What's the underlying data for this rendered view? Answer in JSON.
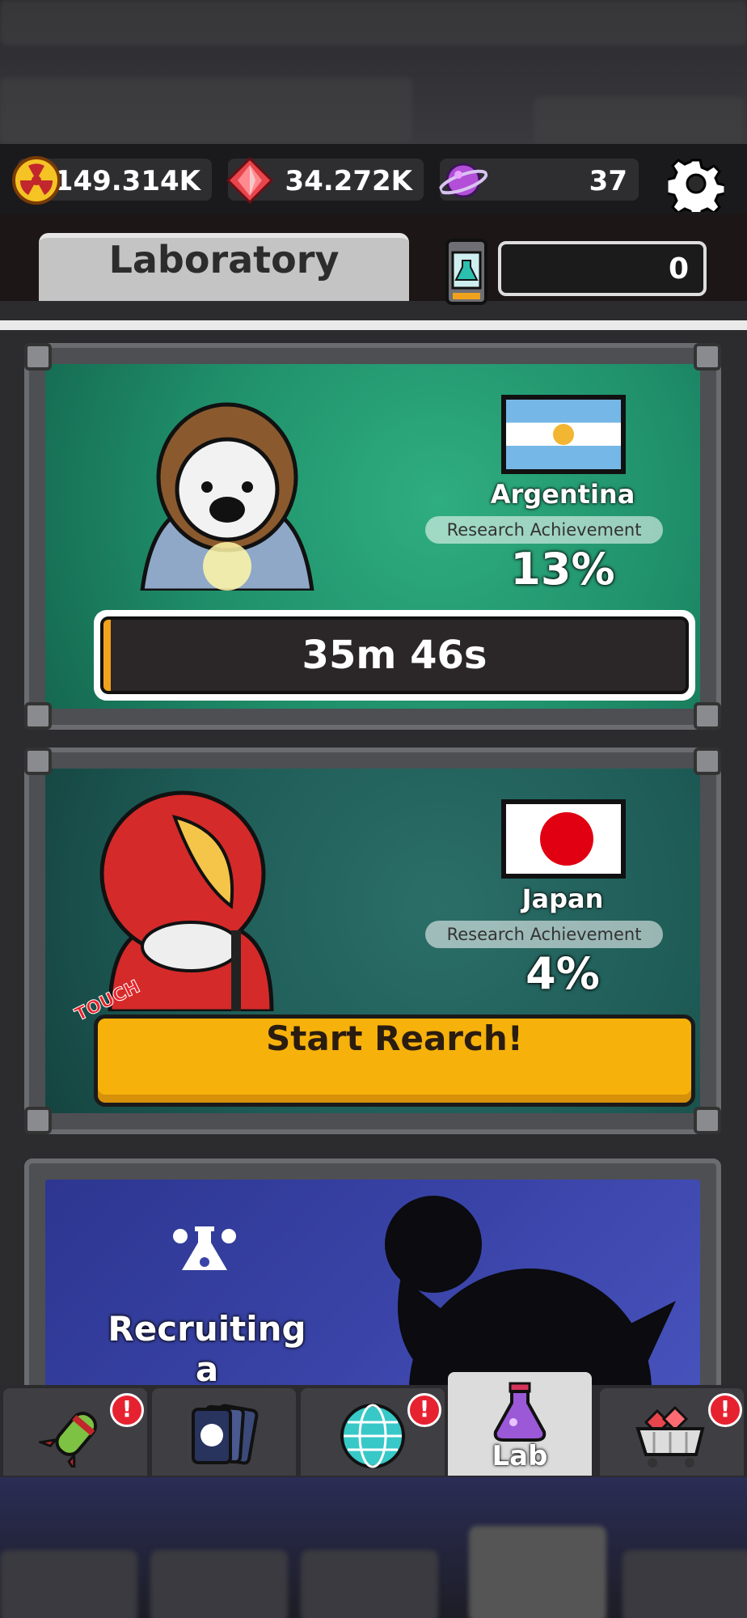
{
  "currencies": {
    "nuclear": {
      "value": "149.314K",
      "icon": "nuclear-icon"
    },
    "gem": {
      "value": "34.272K",
      "icon": "red-gem-icon"
    },
    "planet": {
      "value": "37",
      "icon": "planet-icon"
    }
  },
  "header": {
    "tab_label": "Laboratory",
    "ticket_count": "0"
  },
  "research": [
    {
      "country": "Argentina",
      "achievement_label": "Research Achievement",
      "achievement": "13%",
      "timer": "35m 46s"
    },
    {
      "country": "Japan",
      "achievement_label": "Research Achievement",
      "achievement": "4%",
      "action_label": "Start Rearch!",
      "touch_label": "TOUCH"
    }
  ],
  "recruit": {
    "title_line1": "Recruiting",
    "title_line2": "a Researcher!"
  },
  "nav": {
    "items": [
      {
        "icon": "missile-icon",
        "alert": "!"
      },
      {
        "icon": "cards-icon"
      },
      {
        "icon": "globe-icon",
        "alert": "!"
      },
      {
        "icon": "potion-icon",
        "label": "Lab",
        "active": true
      },
      {
        "icon": "shop-cart-icon",
        "alert": "!"
      }
    ]
  },
  "colors": {
    "accent_yellow": "#f6b10b",
    "timer_fill": "#f0a21c",
    "argentina_bg": "#1f8f6a",
    "japan_bg": "#1e5b56",
    "recruit_bg": "#3a44a8",
    "alert_red": "#e62230"
  }
}
